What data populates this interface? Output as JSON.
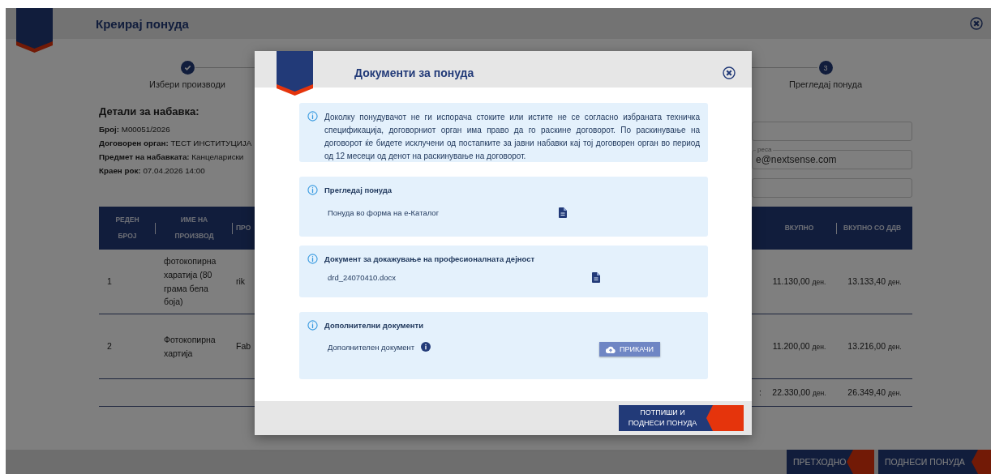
{
  "page": {
    "title": "Креирај понуда"
  },
  "steps": [
    {
      "kind": "done",
      "label": "Избери производи"
    },
    {
      "kind": "current",
      "number": "3",
      "label": "Прегледај понуда"
    }
  ],
  "details": {
    "heading": "Детали за набавка:",
    "rows": [
      {
        "label": "Број:",
        "value": "M00051/2026"
      },
      {
        "label": "Договорен орган:",
        "value": "ТЕСТ ИНСТИТУЦИЈА"
      },
      {
        "label": "Предмет на набавката:",
        "value": "Канцелариски"
      },
      {
        "label": "Краен рок:",
        "value": "07.04.2026 14:00"
      }
    ]
  },
  "contact_fields": [
    {
      "kind": "blank"
    },
    {
      "kind": "filled",
      "label": "реса",
      "value": "e@nextsense.com"
    },
    {
      "kind": "blank"
    }
  ],
  "table": {
    "columns": [
      "РЕДЕН БРОЈ",
      "ИМЕ НА ПРОИЗВОД",
      "ПРО",
      "ВКУПНО",
      "ВКУПНО СО ДДВ"
    ],
    "rows": [
      {
        "number": "1",
        "name": "фотокопирна харатија (80 грама бела боја)",
        "column_3": "rik",
        "total": {
          "amount": "11.130,00",
          "currency": "ден."
        },
        "total_vat": {
          "amount": "13.133,40",
          "currency": "ден."
        }
      },
      {
        "number": "2",
        "name": "Фотокопирна хартија",
        "column_3": "Fab",
        "total": {
          "amount": "11.200,00",
          "currency": "ден."
        },
        "total_vat": {
          "amount": "13.216,00",
          "currency": "ден."
        }
      }
    ],
    "summary": {
      "label": ":",
      "total": {
        "amount": "22.330,00",
        "currency": "ден."
      },
      "total_vat": {
        "amount": "26.349,40",
        "currency": "ден."
      }
    }
  },
  "footer_buttons": [
    "ПРЕТХОДНО",
    "ПОДНЕСИ ПОНУДА"
  ],
  "modal": {
    "title": "Документи за понуда",
    "notice": "Доколку понудувачот не ги испорача стоките или истите не се согласно избраната техничка спецификација, договорниот орган има право да го раскине договорот. По раскинување на договорот ќе бидете исклучени од постапките за јавни набавки кај тој договорен орган во период од 12 месеци од денот на раскинување на договорот.",
    "sections": [
      {
        "kind": "file",
        "title": "Прегледај понуда",
        "item": "Понуда во форма на е-Каталог"
      },
      {
        "kind": "file",
        "title": "Документ за докажување на професионалната дејност",
        "item": "drd_24070410.docx"
      },
      {
        "kind": "upload",
        "title": "Дополнителни документи",
        "item": "Дополнителен документ",
        "button": "ПРИКАЧИ"
      }
    ],
    "submit": "ПОТПИШИ И ПОДНЕСИ ПОНУДА"
  }
}
